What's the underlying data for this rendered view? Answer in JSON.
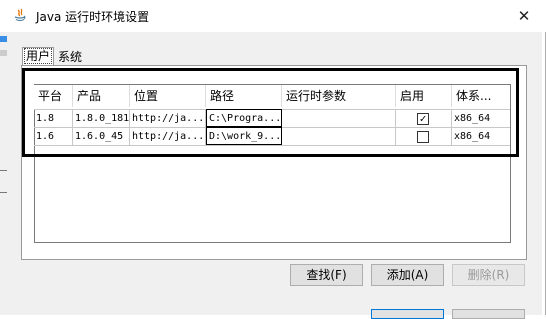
{
  "window": {
    "title": "Java 运行时环境设置",
    "close_glyph": "✕"
  },
  "tabs": [
    {
      "label": "用户"
    },
    {
      "label": "系统"
    }
  ],
  "table": {
    "columns": [
      "平台",
      "产品",
      "位置",
      "路径",
      "运行时参数",
      "启用",
      "体系..."
    ],
    "rows": [
      {
        "platform": "1.8",
        "product": "1.8.0_181",
        "location": "http://ja...",
        "path": "C:\\Progra...",
        "params": "",
        "enabled": true,
        "arch": "x86_64"
      },
      {
        "platform": "1.6",
        "product": "1.6.0_45",
        "location": "http://ja...",
        "path": "D:\\work_9...",
        "params": "",
        "enabled": false,
        "arch": "x86_64"
      }
    ]
  },
  "buttons": {
    "find": "查找(F)",
    "add": "添加(A)",
    "remove": "删除(R)"
  },
  "icons": {
    "app": "java-icon",
    "check": "✓"
  },
  "colors": {
    "accent": "#0078d7",
    "panel": "#f0f0f0",
    "highlight_border": "#000000"
  }
}
